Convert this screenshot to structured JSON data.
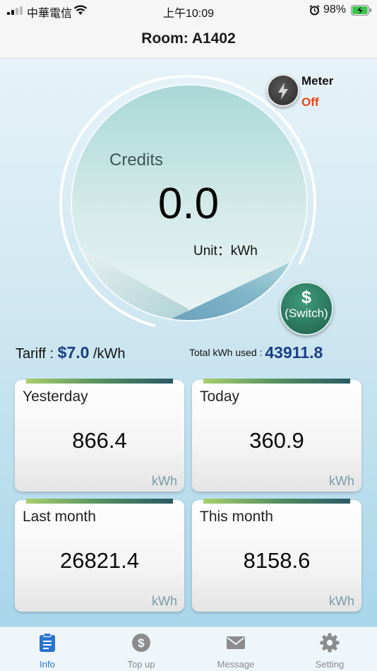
{
  "status_bar": {
    "carrier": "中華電信",
    "time": "上午10:09",
    "battery_percent": "98%",
    "battery_level": 0.98
  },
  "header": {
    "title": "Room: A1402"
  },
  "meter": {
    "label": "Meter",
    "status": "Off",
    "status_color": "#e8431a"
  },
  "credits": {
    "label": "Credits",
    "value": "0.0",
    "unit": "Unit：kWh"
  },
  "switch_button": {
    "symbol": "$",
    "label": "(Switch)"
  },
  "tariff": {
    "label": "Tariff :",
    "value": "$7.0",
    "unit": "/kWh"
  },
  "total": {
    "label": "Total kWh used :",
    "value": "43911.8"
  },
  "stats": [
    {
      "title": "Yesterday",
      "value": "866.4",
      "unit": "kWh"
    },
    {
      "title": "Today",
      "value": "360.9",
      "unit": "kWh"
    },
    {
      "title": "Last month",
      "value": "26821.4",
      "unit": "kWh"
    },
    {
      "title": "This month",
      "value": "8158.6",
      "unit": "kWh"
    }
  ],
  "nav": [
    {
      "label": "Info",
      "icon": "clipboard-icon",
      "active": true
    },
    {
      "label": "Top up",
      "icon": "dollar-coin-icon",
      "active": false
    },
    {
      "label": "Message",
      "icon": "envelope-icon",
      "active": false
    },
    {
      "label": "Setting",
      "icon": "gear-icon",
      "active": false
    }
  ],
  "colors": {
    "accent_blue": "#1b3f86",
    "nav_active": "#2a73cf",
    "meter_off": "#e8431a"
  }
}
